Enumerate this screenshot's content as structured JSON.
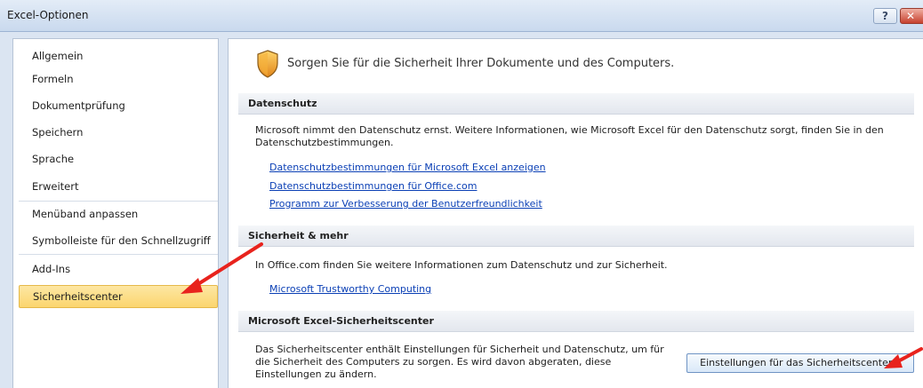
{
  "window": {
    "title": "Excel-Optionen",
    "help_label": "?",
    "close_label": "✕"
  },
  "sidebar": {
    "items": [
      {
        "label": "Allgemein"
      },
      {
        "label": "Formeln"
      },
      {
        "label": "Dokumentprüfung"
      },
      {
        "label": "Speichern"
      },
      {
        "label": "Sprache"
      },
      {
        "label": "Erweitert"
      },
      {
        "label": "Menüband anpassen"
      },
      {
        "label": "Symbolleiste für den Schnellzugriff"
      },
      {
        "label": "Add-Ins"
      },
      {
        "label": "Sicherheitscenter",
        "active": true
      }
    ]
  },
  "main": {
    "icon": "shield-icon",
    "headline": "Sorgen Sie für die Sicherheit Ihrer Dokumente und des Computers.",
    "sections": {
      "privacy": {
        "heading": "Datenschutz",
        "text_line1": "Microsoft nimmt den Datenschutz ernst. Weitere Informationen, wie Microsoft Excel für den Datenschutz sorgt, finden Sie in den",
        "text_line2": "Datenschutzbestimmungen.",
        "links": [
          "Datenschutzbestimmungen für Microsoft Excel anzeigen",
          "Datenschutzbestimmungen für Office.com",
          "Programm zur Verbesserung der Benutzerfreundlichkeit"
        ]
      },
      "security": {
        "heading": "Sicherheit & mehr",
        "text": "In Office.com finden Sie weitere Informationen zum Datenschutz und zur Sicherheit.",
        "link": "Microsoft Trustworthy Computing"
      },
      "trust_center": {
        "heading": "Microsoft Excel-Sicherheitscenter",
        "text_line1": "Das Sicherheitscenter enthält Einstellungen für Sicherheit und Datenschutz, um für",
        "text_line2": "die Sicherheit des Computers zu sorgen. Es wird davon abgeraten, diese",
        "text_line3": "Einstellungen zu ändern.",
        "button_label": "Einstellungen für das Sicherheitscenter..."
      }
    }
  },
  "colors": {
    "active_nav": "#fbd56e",
    "link": "#0a3fb5",
    "arrow": "#e8231d"
  }
}
